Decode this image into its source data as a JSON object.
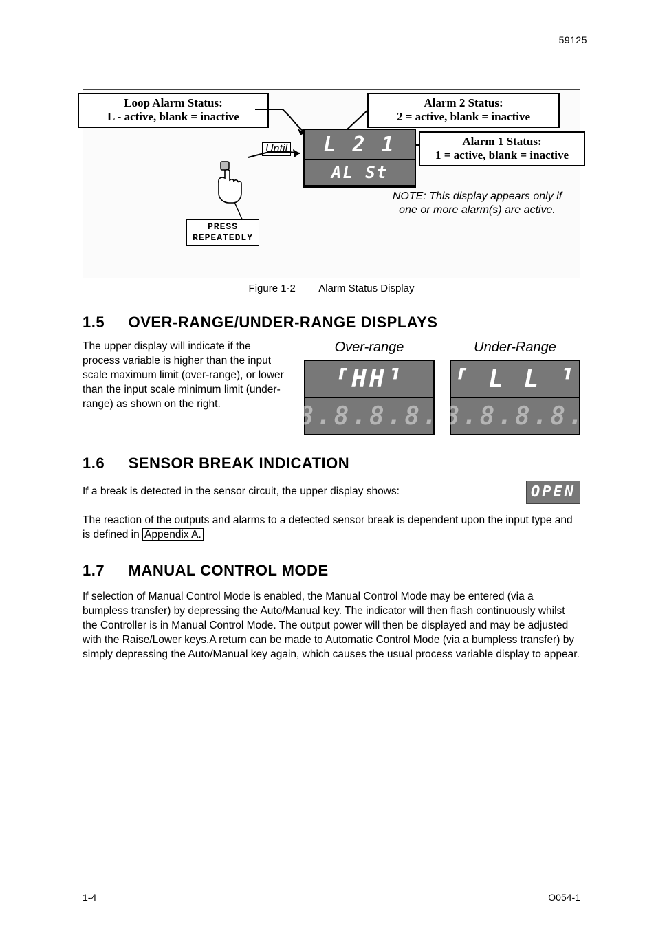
{
  "header": {
    "doc_number": "59125"
  },
  "figure": {
    "callouts": {
      "loop_alarm_title": "Loop Alarm Status:",
      "loop_alarm_sub": "L - active, blank = inactive",
      "alarm2_title": "Alarm 2 Status:",
      "alarm2_sub": "2 = active, blank = inactive",
      "alarm1_title": "Alarm 1 Status:",
      "alarm1_sub": "1 = active, blank = inactive"
    },
    "display_top": "L 2 1",
    "display_bottom": "AL St",
    "until_label": "Until",
    "press_line1": "PRESS",
    "press_line2": "REPEATEDLY",
    "note": "NOTE: This display appears only if one or more alarm(s) are active.",
    "caption_figno": "Figure 1-2",
    "caption_text": "Alarm Status Display"
  },
  "sec_1_5": {
    "num": "1.5",
    "title": "OVER-RANGE/UNDER-RANGE DISPLAYS",
    "body": "The upper display will indicate if the process variable is higher than the input scale maximum limit (over-range), or lower than the input scale minimum limit (under-range) as shown on the right.",
    "over_label": "Over-range",
    "under_label": "Under-Range",
    "over_seg": "⸢HH⸣",
    "under_seg": "⸢ L L ⸣",
    "dim_seg": "8.8.8.8."
  },
  "sec_1_6": {
    "num": "1.6",
    "title": "SENSOR BREAK INDICATION",
    "line1": "If a break is detected in the sensor circuit, the upper display shows:",
    "open_seg": "OPEN",
    "line2_pre": "The reaction of the outputs and alarms to a detected sensor break is dependent upon the input type and is defined in ",
    "appendix": "Appendix A."
  },
  "sec_1_7": {
    "num": "1.7",
    "title": "MANUAL CONTROL MODE",
    "body": "If selection of Manual Control Mode is enabled, the Manual Control Mode may be entered (via a bumpless transfer) by depressing the Auto/Manual key. The indicator will then flash continuously whilst the Controller is in Manual Control Mode. The output power will then be displayed and may be adjusted with the Raise/Lower keys.A return can be made to Automatic Control Mode (via a bumpless transfer) by simply depressing the Auto/Manual key again, which causes the usual process variable display to appear."
  },
  "footer": {
    "left": "1-4",
    "right": "O054-1"
  }
}
